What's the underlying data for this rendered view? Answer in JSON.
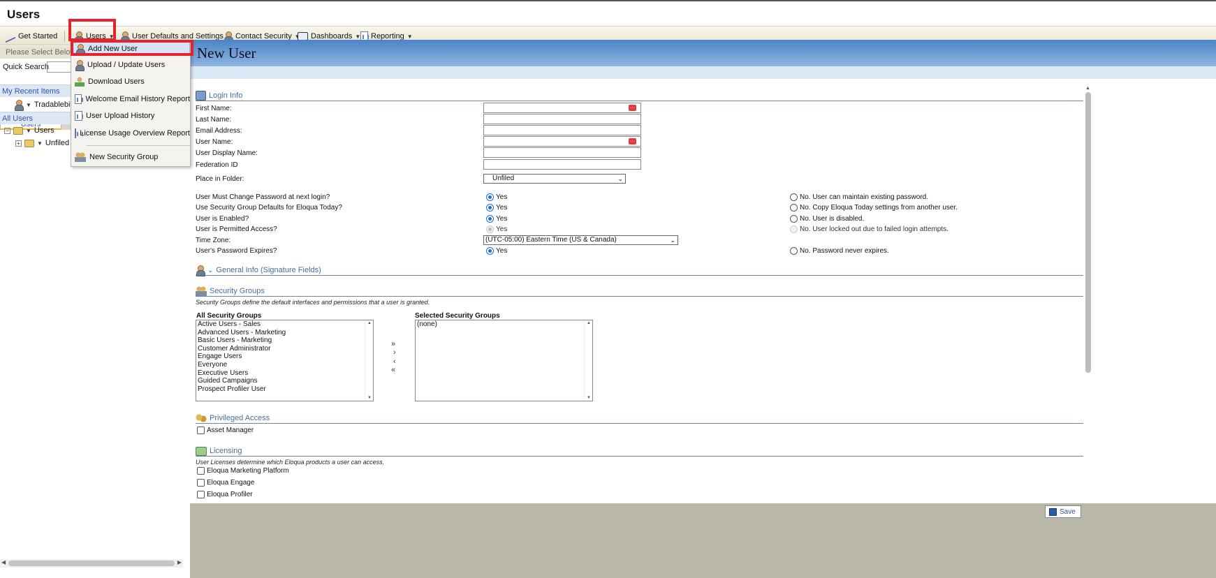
{
  "page": {
    "title": "Users"
  },
  "toolbar": {
    "get_started": "Get Started",
    "users": "Users",
    "user_defaults": "User Defaults and Settings",
    "contact_security": "Contact Security",
    "dashboards": "Dashboards",
    "reporting": "Reporting"
  },
  "users_menu": {
    "items": [
      {
        "label": "Add New User",
        "icon": "user-icon"
      },
      {
        "label": "Upload / Update Users",
        "icon": "user-icon"
      },
      {
        "label": "Download Users",
        "icon": "download-icon"
      },
      {
        "label": "Welcome Email History Report",
        "icon": "report-icon"
      },
      {
        "label": "User Upload History",
        "icon": "report-icon"
      },
      {
        "label": "License Usage Overview Report",
        "icon": "report-icon"
      },
      {
        "label": "New Security Group",
        "icon": "security-group-icon"
      }
    ]
  },
  "left": {
    "please_select": "Please Select Below",
    "quick_search_label": "Quick Search",
    "tab_users": "Users",
    "recent_items": "My Recent Items",
    "recent_item_1": "Tradablebits",
    "all_users": "All Users",
    "tree_users": "Users",
    "tree_unfiled": "Unfiled"
  },
  "form": {
    "title": "New User",
    "login_info": "Login Info",
    "fields": {
      "first_name": "First Name:",
      "last_name": "Last Name:",
      "email": "Email Address:",
      "user_name": "User Name:",
      "display_name": "User Display Name:",
      "federation_id": "Federation ID",
      "place_in_folder": "Place in Folder:",
      "folder_value": "Unfiled"
    },
    "questions": {
      "must_change_pw": "User Must Change Password at next login?",
      "use_sg_defaults": "Use Security Group Defaults for Eloqua Today?",
      "is_enabled": "User is Enabled?",
      "is_permitted": "User is Permitted Access?",
      "time_zone": "Time Zone:",
      "time_zone_value": "(UTC-05:00) Eastern Time (US & Canada)",
      "pw_expires": "User's Password Expires?"
    },
    "answers": {
      "yes": "Yes",
      "no_maintain_pw": "No. User can maintain existing password.",
      "no_copy_today": "No. Copy Eloqua Today settings from another user.",
      "no_disabled": "No. User is disabled.",
      "no_locked": "No. User locked out due to failed login attempts.",
      "no_never_expires": "No. Password never expires."
    },
    "general_info": "General Info (Signature Fields)",
    "security_groups": {
      "title": "Security Groups",
      "desc": "Security Groups define the default interfaces and permissions that a user is granted.",
      "all_label": "All Security Groups",
      "selected_label": "Selected Security Groups",
      "all": [
        "Active Users - Sales",
        "Advanced Users - Marketing",
        "Basic Users - Marketing",
        "Customer Administrator",
        "Engage Users",
        "Everyone",
        "Executive Users",
        "Guided Campaigns",
        "Prospect Profiler User"
      ],
      "selected": [
        "(none)"
      ],
      "btn_add_all": "»",
      "btn_add": "›",
      "btn_remove": "‹",
      "btn_remove_all": "«"
    },
    "privileged": {
      "title": "Privileged Access",
      "asset_manager": "Asset Manager"
    },
    "licensing": {
      "title": "Licensing",
      "desc": "User Licenses determine which Eloqua products a user can access.",
      "items": [
        "Eloqua Marketing Platform",
        "Eloqua Engage",
        "Eloqua Profiler"
      ]
    },
    "save": "Save"
  }
}
